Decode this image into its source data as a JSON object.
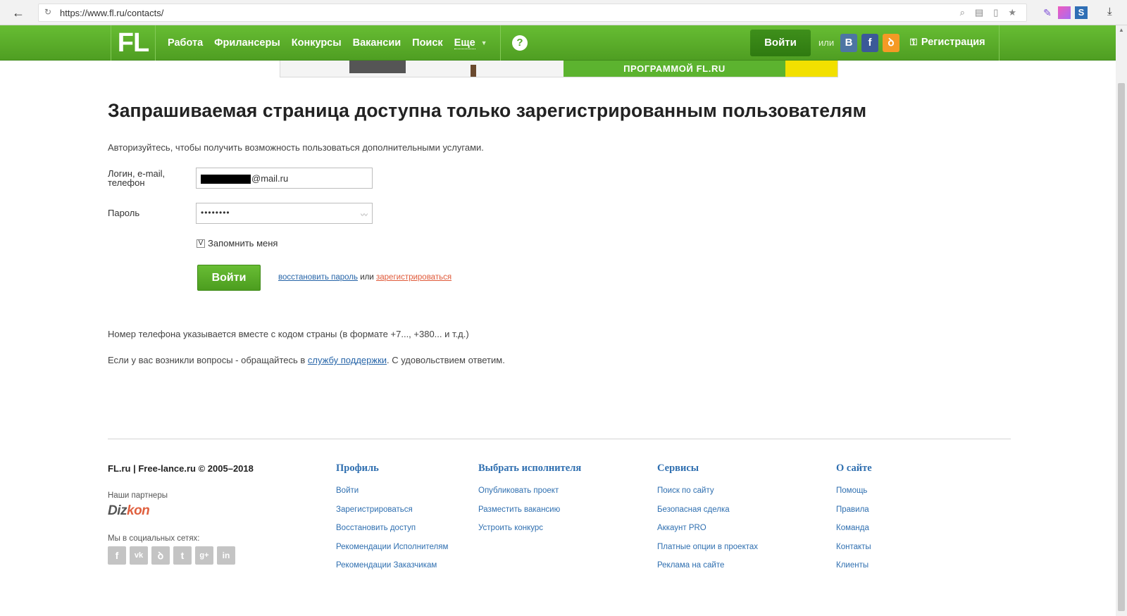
{
  "browser": {
    "url": "https://www.fl.ru/contacts/"
  },
  "nav": {
    "logo": "FL",
    "links": [
      "Работа",
      "Фрилансеры",
      "Конкурсы",
      "Вакансии",
      "Поиск",
      "Еще"
    ],
    "help": "?",
    "login_button": "Войти",
    "or_text": "или",
    "social": [
      "B",
      "f",
      "ok"
    ],
    "register": "Регистрация"
  },
  "banner": {
    "text": "ПРОГРАММОЙ FL.RU"
  },
  "main": {
    "title": "Запрашиваемая страница доступна только зарегистрированным пользователям",
    "intro": "Авторизуйтесь, чтобы получить возможность пользоваться дополнительными услугами.",
    "login_label": "Логин, e-mail, телефон",
    "login_value": "@mail.ru",
    "password_label": "Пароль",
    "password_value": "••••••••",
    "remember_label": "Запомнить меня",
    "remember_checked": "V",
    "submit": "Войти",
    "recover_link": "восстановить пароль",
    "or_text": "или",
    "register_link": "зарегистрироваться",
    "phone_note": "Номер телефона указывается вместе с кодом страны (в формате +7..., +380... и т.д.)",
    "support_prefix": "Если у вас возникли вопросы - обращайтесь в",
    "support_link": "службу поддержки",
    "support_suffix": ". С удовольствием ответим."
  },
  "footer": {
    "copyright": "FL.ru | Free-lance.ru © 2005–2018",
    "partners_label": "Наши партнеры",
    "partner_logo_a": "Diz",
    "partner_logo_b": "kon",
    "social_label": "Мы в социальных сетях:",
    "social_icons": [
      "f",
      "vk",
      "ok",
      "tw",
      "g+",
      "in"
    ],
    "columns": [
      {
        "title": "Профиль",
        "items": [
          "Войти",
          "Зарегистрироваться",
          "Восстановить доступ",
          "Рекомендации Исполнителям",
          "Рекомендации Заказчикам"
        ]
      },
      {
        "title": "Выбрать исполнителя",
        "items": [
          "Опубликовать проект",
          "Разместить вакансию",
          "Устроить конкурс"
        ]
      },
      {
        "title": "Сервисы",
        "items": [
          "Поиск по сайту",
          "Безопасная сделка",
          "Аккаунт PRO",
          "Платные опции в проектах",
          "Реклама на сайте"
        ]
      },
      {
        "title": "О сайте",
        "items": [
          "Помощь",
          "Правила",
          "Команда",
          "Контакты",
          "Клиенты"
        ]
      }
    ]
  },
  "colors": {
    "brand_green": "#5cb32f",
    "link_blue": "#2765a8",
    "link_red": "#e05a3a"
  }
}
